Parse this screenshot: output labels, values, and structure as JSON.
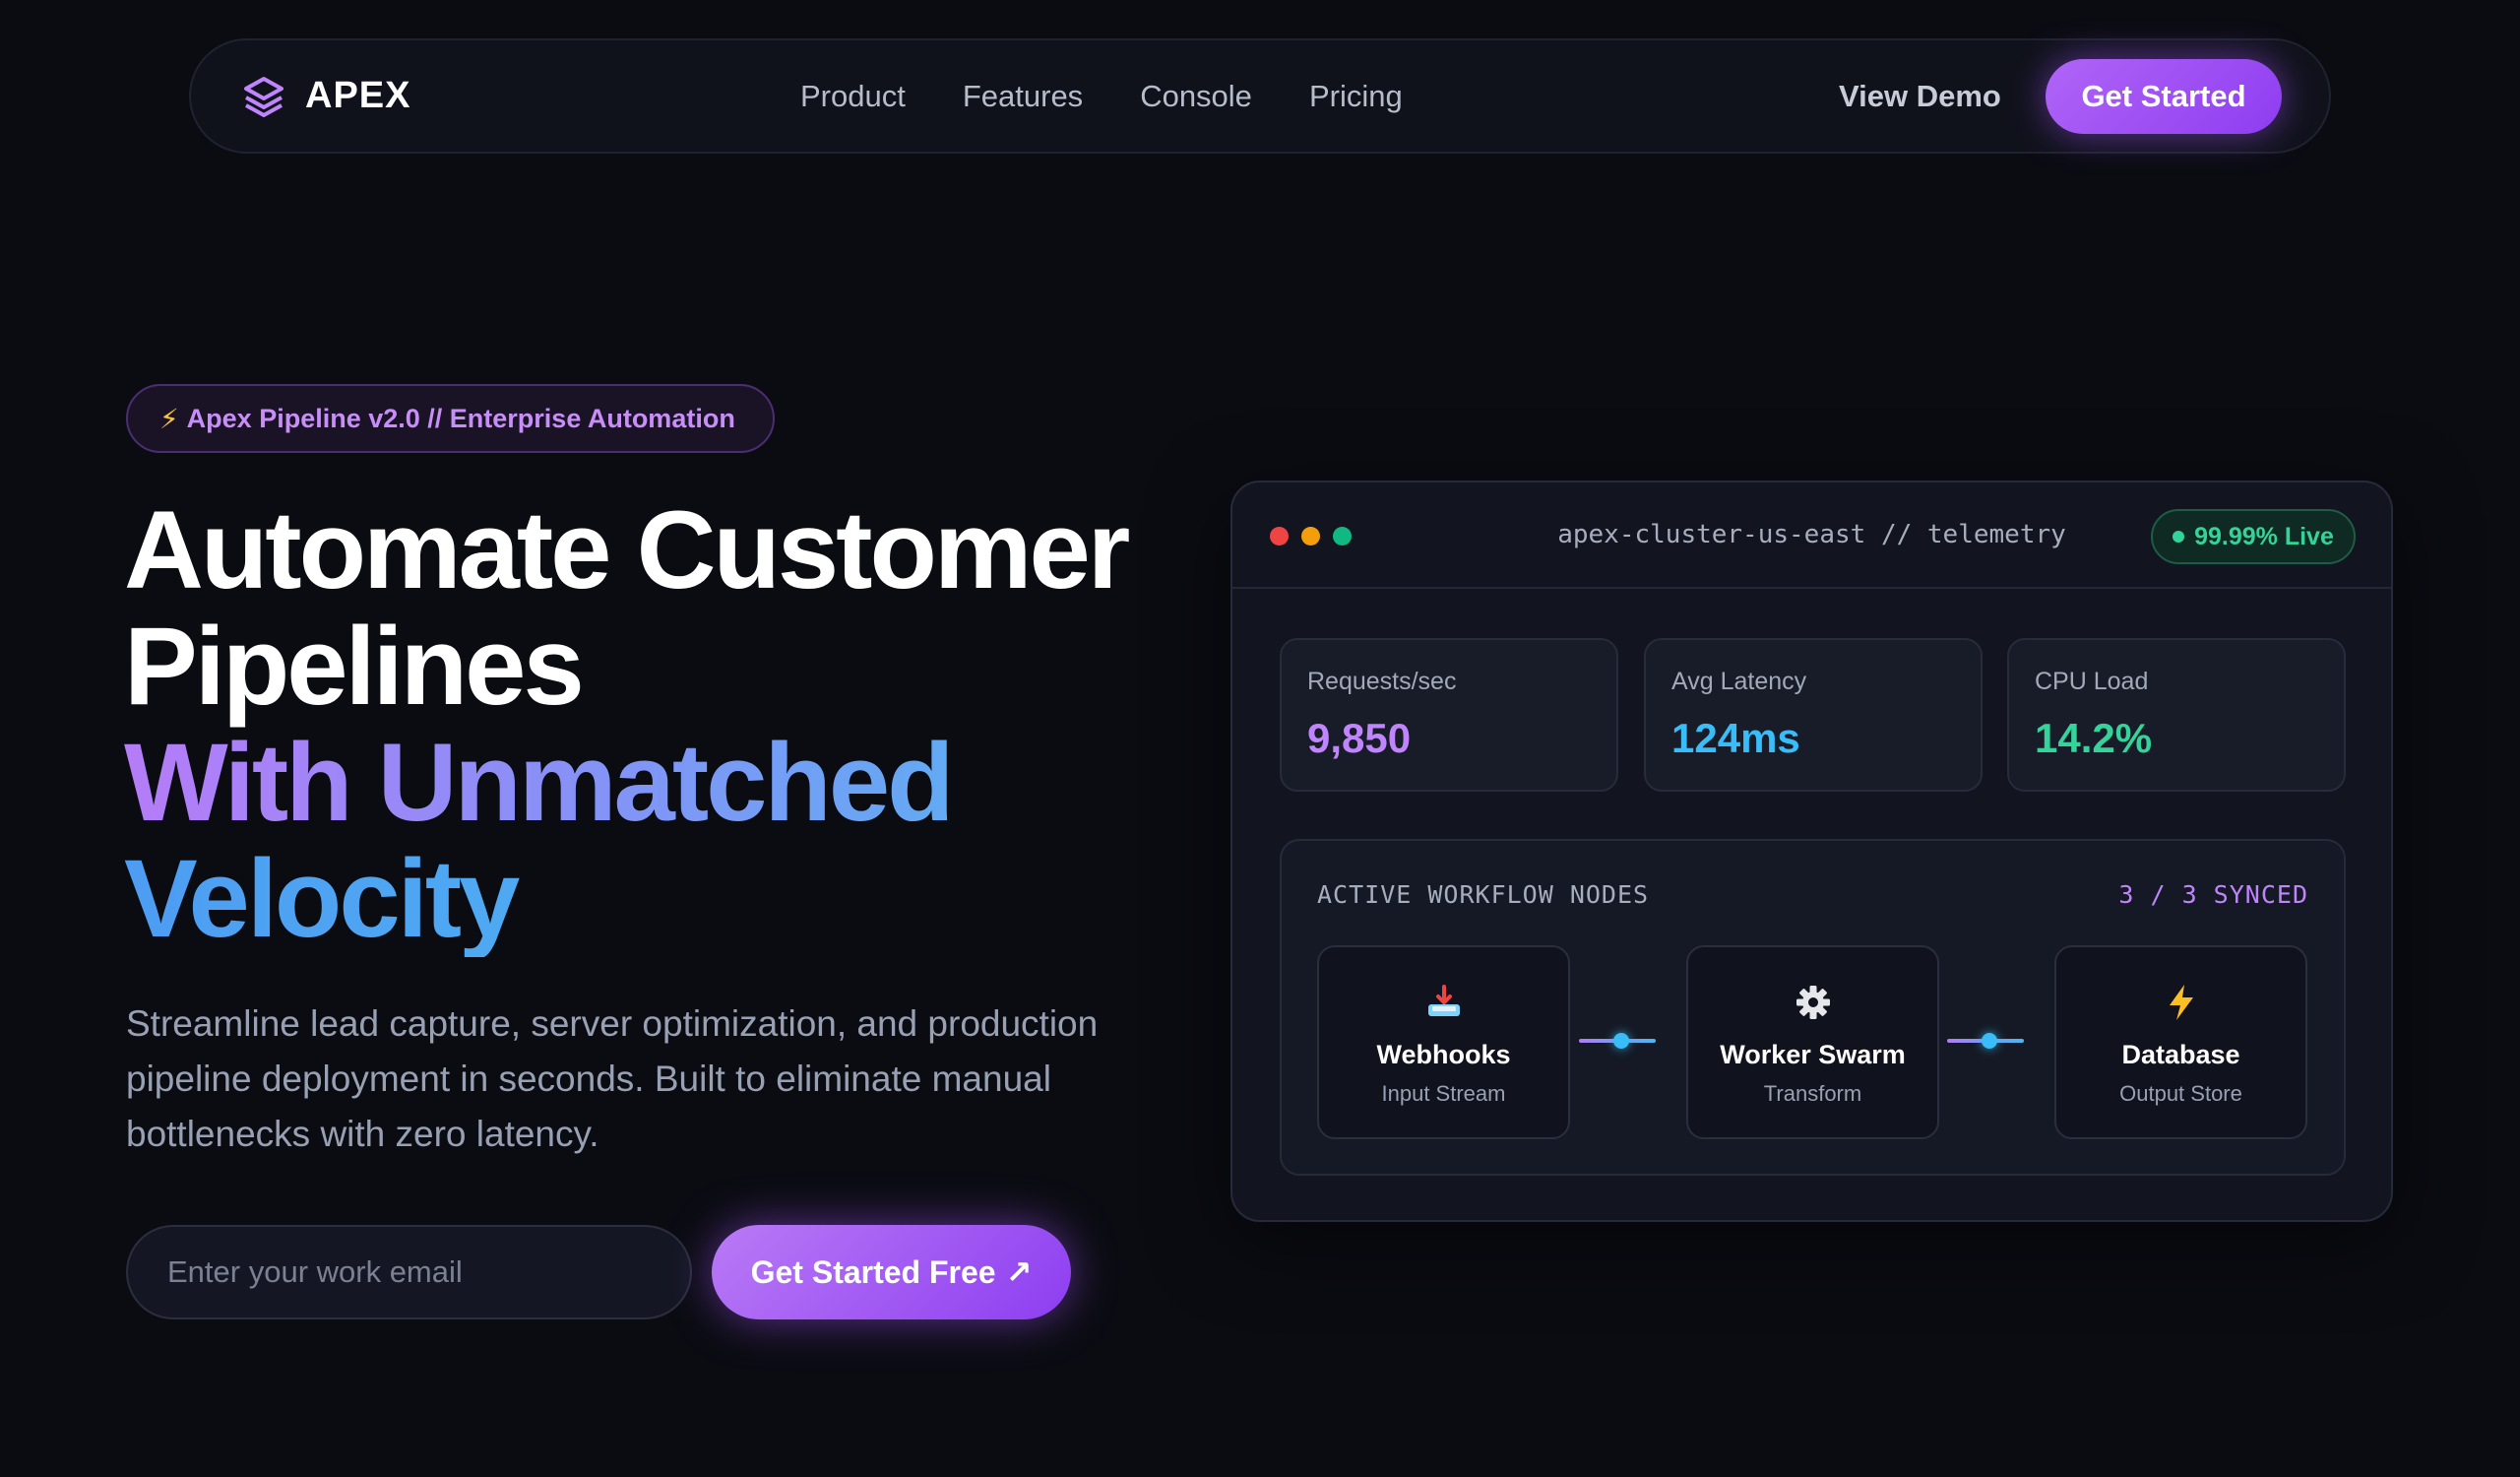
{
  "nav": {
    "brand": "APEX",
    "links": [
      "Product",
      "Features",
      "Console",
      "Pricing"
    ],
    "view_demo": "View Demo",
    "get_started": "Get Started"
  },
  "hero": {
    "badge": "Apex Pipeline v2.0 // Enterprise Automation",
    "headline_line1": "Automate Customer",
    "headline_line2": "Pipelines",
    "headline_line3": "With Unmatched",
    "headline_line4": "Velocity",
    "lead": "Streamline lead capture, server optimization, and production pipeline deployment in seconds. Built to eliminate manual bottlenecks with zero latency.",
    "email_placeholder": "Enter your work email",
    "cta": "Get Started Free",
    "cta_icon": "↗"
  },
  "dashboard": {
    "title": "apex-cluster-us-east // telemetry",
    "live_status": "99.99% Live",
    "stats": [
      {
        "label": "Requests/sec",
        "value": "9,850"
      },
      {
        "label": "Avg Latency",
        "value": "124ms"
      },
      {
        "label": "CPU Load",
        "value": "14.2%"
      }
    ],
    "workflow_title": "ACTIVE WORKFLOW NODES",
    "workflow_sync": "3 / 3 SYNCED",
    "nodes": [
      {
        "name": "Webhooks",
        "subtitle": "Input Stream",
        "icon": "inbox-tray-icon"
      },
      {
        "name": "Worker Swarm",
        "subtitle": "Transform",
        "icon": "gear-icon"
      },
      {
        "name": "Database",
        "subtitle": "Output Store",
        "icon": "lightning-icon"
      }
    ]
  },
  "colors": {
    "accent_purple": "#a855f7",
    "accent_blue": "#38bdf8",
    "accent_green": "#34d399",
    "background": "#0b0c12"
  }
}
